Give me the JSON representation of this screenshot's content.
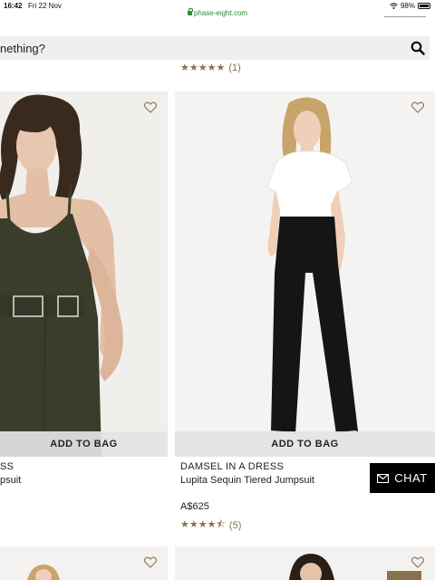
{
  "status": {
    "time": "16:42",
    "date": "Fri 22 Nov",
    "battery": "98%",
    "battery_level": 0.98
  },
  "browser": {
    "url": "phase-eight.com"
  },
  "search": {
    "placeholder": "nething?"
  },
  "top_rating": {
    "stars": 5,
    "count": "(1)"
  },
  "products": [
    {
      "brand": "SS",
      "name": "psuit",
      "add_to_bag": "ADD TO BAG"
    },
    {
      "brand": "DAMSEL IN A DRESS",
      "name": "Lupita Sequin Tiered Jumpsuit",
      "price": "A$625",
      "rating": 4.5,
      "rating_count": "(5)",
      "add_to_bag": "ADD TO BAG"
    }
  ],
  "chat": {
    "label": "CHAT"
  },
  "colors": {
    "accent_gold": "#8a7150",
    "chat_bg": "#000000",
    "url_green": "#2a8a3a"
  }
}
